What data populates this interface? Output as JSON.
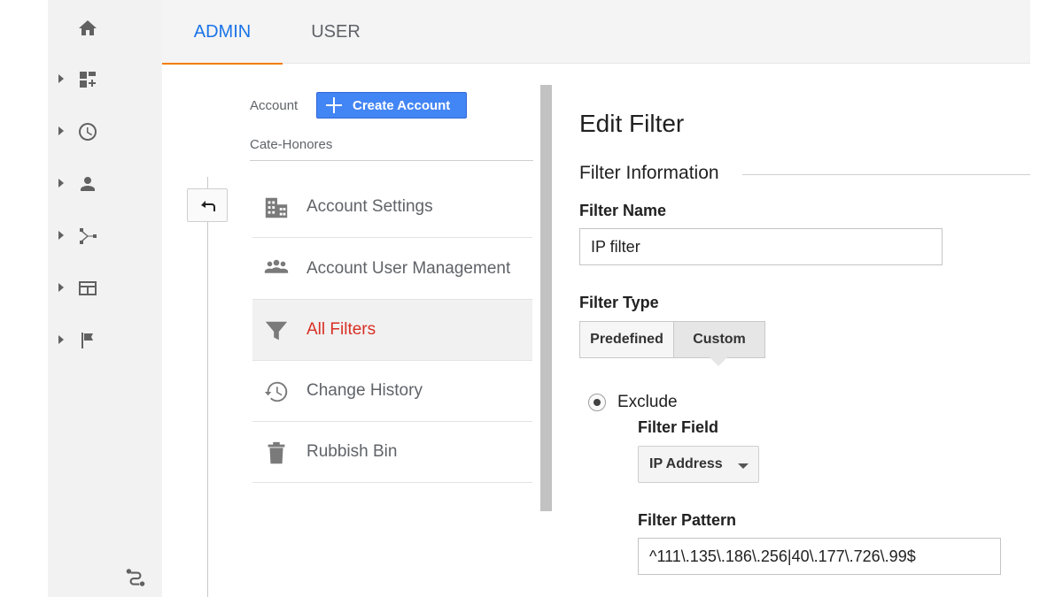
{
  "tabs": {
    "admin": "ADMIN",
    "user": "USER"
  },
  "rail": {
    "icons": [
      "home-icon",
      "dashboard-add-icon",
      "clock-icon",
      "person-icon",
      "acquisition-icon",
      "behavior-icon",
      "flag-icon",
      "discover-icon"
    ]
  },
  "account": {
    "label": "Account",
    "create_button": "Create Account",
    "name": "Cate-Honores"
  },
  "menu": {
    "items": [
      {
        "label": "Account Settings",
        "icon": "building-icon"
      },
      {
        "label": "Account User Management",
        "icon": "people-icon"
      },
      {
        "label": "All Filters",
        "icon": "filter-icon",
        "active": true
      },
      {
        "label": "Change History",
        "icon": "history-icon"
      },
      {
        "label": "Rubbish Bin",
        "icon": "trash-icon"
      }
    ]
  },
  "edit": {
    "title": "Edit Filter",
    "section": "Filter Information",
    "name_label": "Filter Name",
    "name_value": "IP filter",
    "type_label": "Filter Type",
    "type_options": [
      "Predefined",
      "Custom"
    ],
    "type_selected": "Custom",
    "exclude_label": "Exclude",
    "field_label": "Filter Field",
    "field_value": "IP Address",
    "pattern_label": "Filter Pattern",
    "pattern_value": "^111\\.135\\.186\\.256|40\\.177\\.726\\.99$"
  },
  "colors": {
    "accent": "#1a73e8",
    "tab_underline": "#f57c00",
    "active_item": "#d93025",
    "create_button": "#4285f4"
  }
}
